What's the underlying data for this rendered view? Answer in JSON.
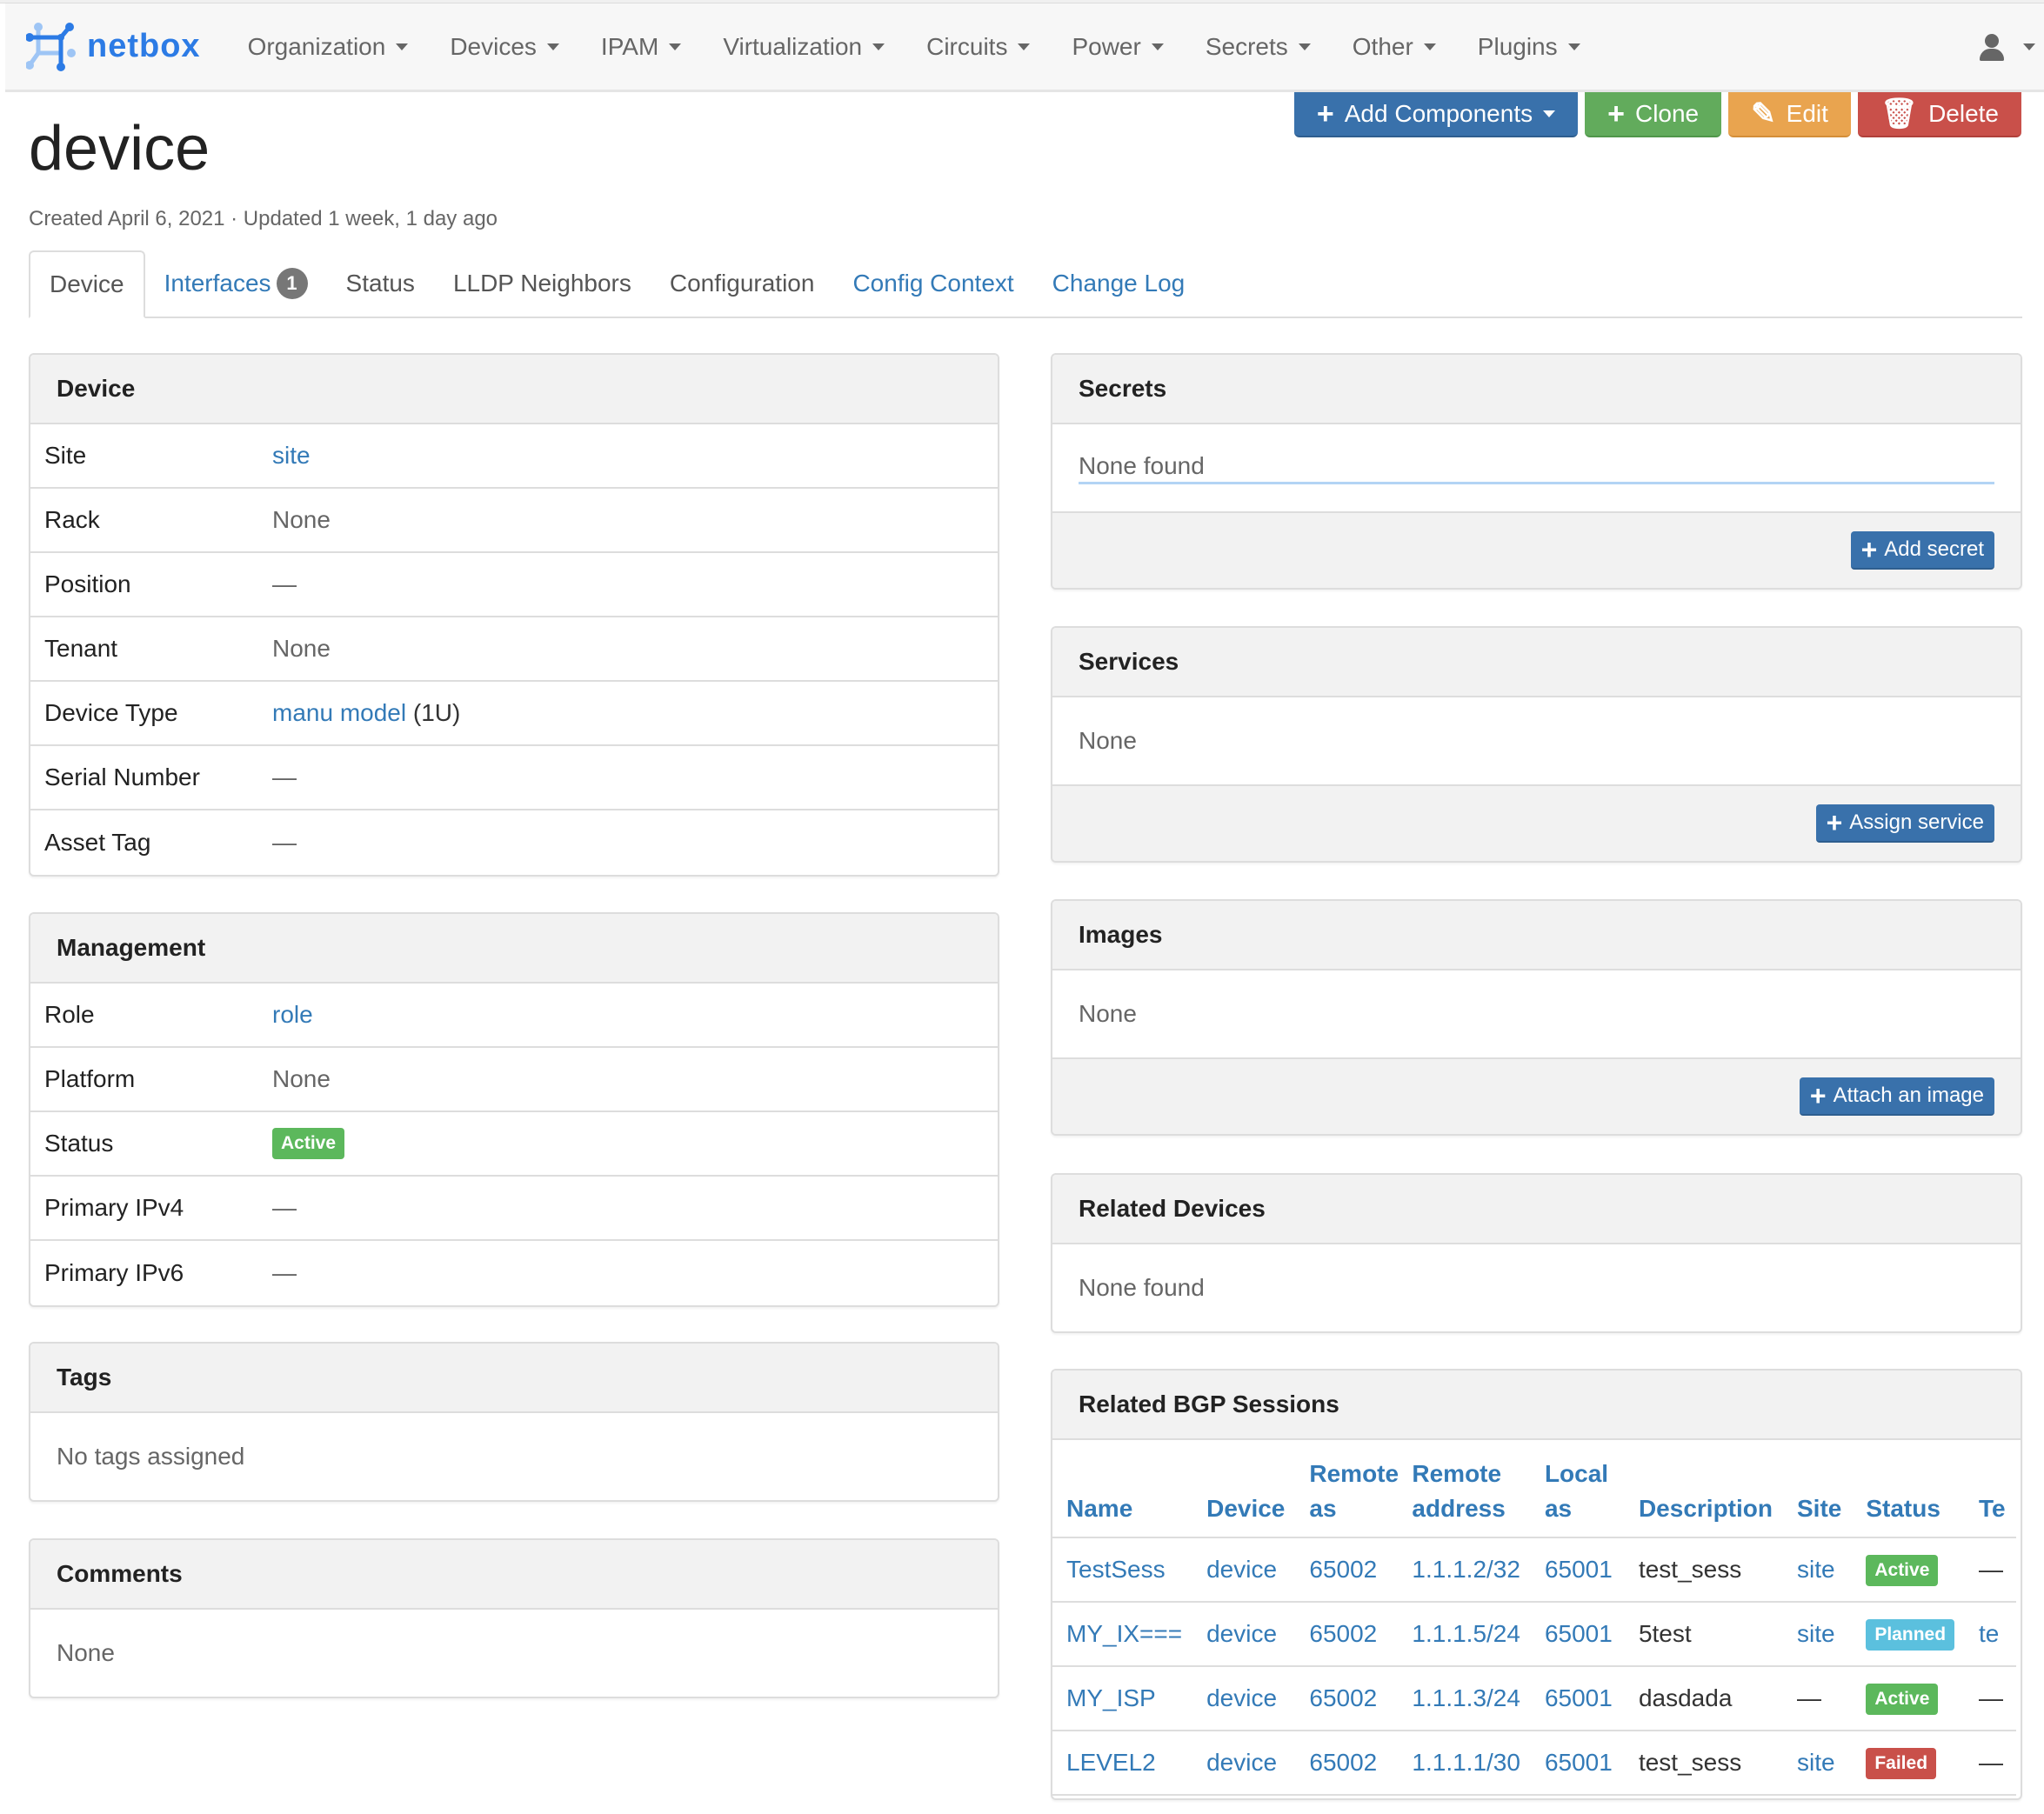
{
  "navbar": {
    "brand": "netbox",
    "items": [
      "Organization",
      "Devices",
      "IPAM",
      "Virtualization",
      "Circuits",
      "Power",
      "Secrets",
      "Other",
      "Plugins"
    ],
    "user_icon": "user-icon"
  },
  "header": {
    "title": "device",
    "meta": "Created April 6, 2021 · Updated 1 week, 1 day ago"
  },
  "actions": {
    "add_components": "Add Components",
    "clone": "Clone",
    "edit": "Edit",
    "delete": "Delete"
  },
  "tabs": [
    {
      "label": "Device",
      "active": true
    },
    {
      "label": "Interfaces",
      "badge": "1"
    },
    {
      "label": "Status"
    },
    {
      "label": "LLDP Neighbors"
    },
    {
      "label": "Configuration"
    },
    {
      "label": "Config Context"
    },
    {
      "label": "Change Log"
    }
  ],
  "device_panel": {
    "title": "Device",
    "rows": [
      {
        "label": "Site",
        "value": "site",
        "link": true
      },
      {
        "label": "Rack",
        "value": "None"
      },
      {
        "label": "Position",
        "value": "—"
      },
      {
        "label": "Tenant",
        "value": "None"
      },
      {
        "label": "Device Type",
        "value": "manu model",
        "link": true,
        "suffix": "(1U)"
      },
      {
        "label": "Serial Number",
        "value": "—"
      },
      {
        "label": "Asset Tag",
        "value": "—"
      }
    ]
  },
  "management_panel": {
    "title": "Management",
    "rows": [
      {
        "label": "Role",
        "value": "role",
        "link": true
      },
      {
        "label": "Platform",
        "value": "None"
      },
      {
        "label": "Status",
        "value": "Active",
        "badge": true
      },
      {
        "label": "Primary IPv4",
        "value": "—"
      },
      {
        "label": "Primary IPv6",
        "value": "—"
      }
    ]
  },
  "tags_panel": {
    "title": "Tags",
    "body": "No tags assigned"
  },
  "comments_panel": {
    "title": "Comments",
    "body": "None"
  },
  "secrets_panel": {
    "title": "Secrets",
    "body": "None found",
    "button": "Add secret"
  },
  "services_panel": {
    "title": "Services",
    "body": "None",
    "button": "Assign service"
  },
  "images_panel": {
    "title": "Images",
    "body": "None",
    "button": "Attach an image"
  },
  "related_devices_panel": {
    "title": "Related Devices",
    "body": "None found"
  },
  "bgp_panel": {
    "title": "Related BGP Sessions",
    "columns": [
      "Name",
      "Device",
      "Remote as",
      "Remote address",
      "Local as",
      "Description",
      "Site",
      "Status",
      "Te"
    ],
    "rows": [
      {
        "name": "TestSess",
        "device": "device",
        "remote_as": "65002",
        "remote_address": "1.1.1.2/32",
        "local_as": "65001",
        "description": "test_sess",
        "site": "site",
        "status": "Active",
        "tenant": "—"
      },
      {
        "name": "MY_IX===",
        "device": "device",
        "remote_as": "65002",
        "remote_address": "1.1.1.5/24",
        "local_as": "65001",
        "description": "5test",
        "site": "site",
        "status": "Planned",
        "tenant": "te"
      },
      {
        "name": "MY_ISP",
        "device": "device",
        "remote_as": "65002",
        "remote_address": "1.1.1.3/24",
        "local_as": "65001",
        "description": "dasdada",
        "site": "—",
        "status": "Active",
        "tenant": "—"
      },
      {
        "name": "LEVEL2",
        "device": "device",
        "remote_as": "65002",
        "remote_address": "1.1.1.1/30",
        "local_as": "65001",
        "description": "test_sess",
        "site": "site",
        "status": "Failed",
        "tenant": "—"
      }
    ]
  },
  "colors": {
    "brand": "#2c7be5",
    "link": "#337ab7",
    "primary": "#3971ab",
    "success": "#5cb85c",
    "info": "#5bc0de",
    "warning": "#e9a44f",
    "danger": "#c9504a"
  }
}
